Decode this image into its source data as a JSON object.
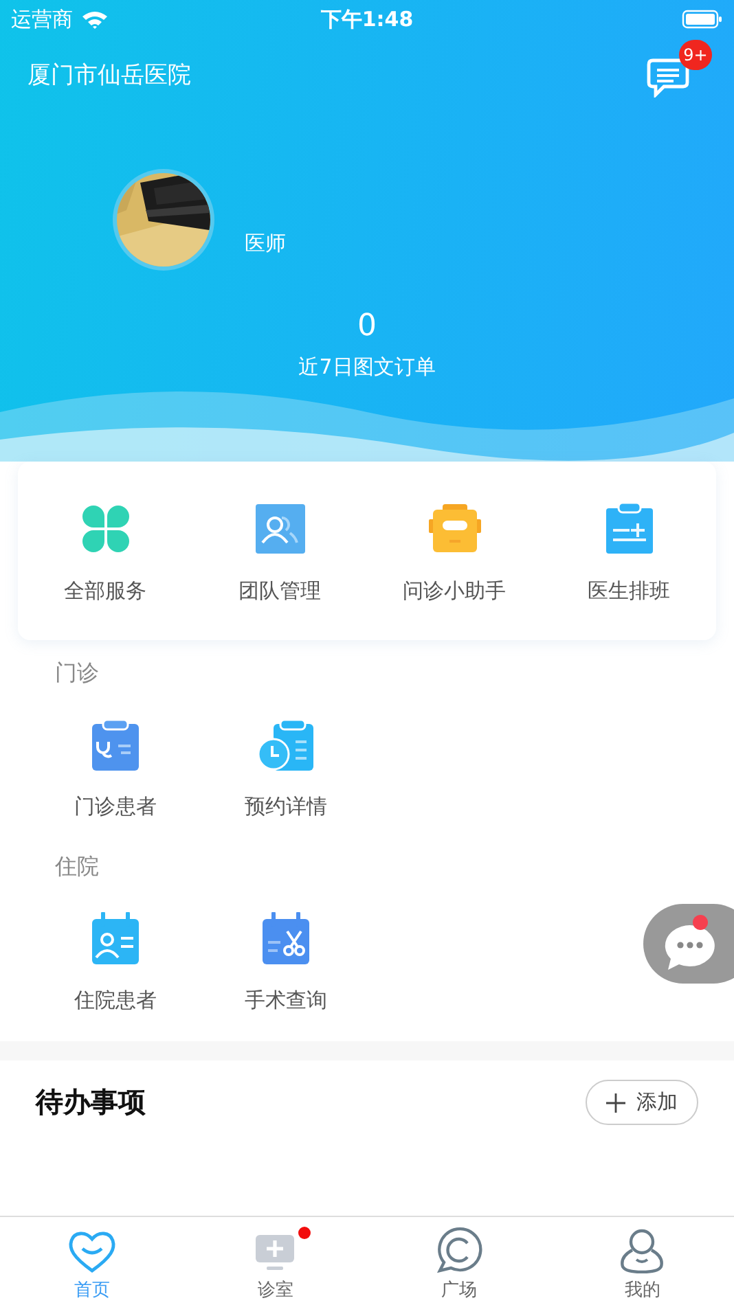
{
  "status_bar": {
    "carrier": "运营商",
    "time": "下午1:48"
  },
  "header": {
    "hospital": "厦门市仙岳医院",
    "message_badge": "9+",
    "role": "医师",
    "order_count": "0",
    "order_label": "近7日图文订单"
  },
  "quick_actions": [
    {
      "label": "全部服务"
    },
    {
      "label": "团队管理"
    },
    {
      "label": "问诊小助手"
    },
    {
      "label": "医生排班"
    }
  ],
  "sections": [
    {
      "title": "门诊",
      "items": [
        {
          "label": "门诊患者"
        },
        {
          "label": "预约详情"
        }
      ]
    },
    {
      "title": "住院",
      "items": [
        {
          "label": "住院患者"
        },
        {
          "label": "手术查询"
        }
      ]
    }
  ],
  "floating_chat": {
    "unread": true
  },
  "todo": {
    "title": "待办事项",
    "add_button": "添加"
  },
  "tab_bar": [
    {
      "label": "首页",
      "selected": true,
      "dot": false
    },
    {
      "label": "诊室",
      "selected": false,
      "dot": true
    },
    {
      "label": "广场",
      "selected": false,
      "dot": false
    },
    {
      "label": "我的",
      "selected": false,
      "dot": false
    }
  ]
}
